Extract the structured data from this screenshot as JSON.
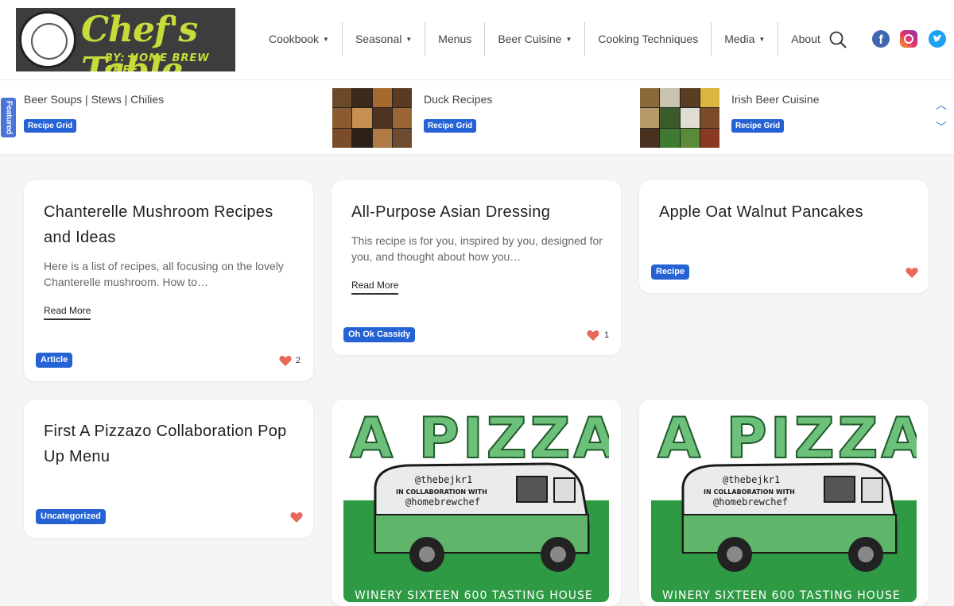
{
  "brand": {
    "title": "Chef's Table",
    "subtitle": "BY: HOME BREW CHEF"
  },
  "nav": {
    "items": [
      {
        "label": "Cookbook",
        "dropdown": true
      },
      {
        "label": "Seasonal",
        "dropdown": true
      },
      {
        "label": "Menus",
        "dropdown": false
      },
      {
        "label": "Beer Cuisine",
        "dropdown": true
      },
      {
        "label": "Cooking Techniques",
        "dropdown": false
      },
      {
        "label": "Media",
        "dropdown": true
      },
      {
        "label": "About",
        "dropdown": false
      }
    ],
    "caret": "▼"
  },
  "social": {
    "facebook": "f"
  },
  "featured": {
    "tab_label": "Featured",
    "items": [
      {
        "label": "Beer Soups | Stews | Chilies",
        "badge": "Recipe Grid"
      },
      {
        "label": "Duck Recipes",
        "badge": "Recipe Grid"
      },
      {
        "label": "Irish Beer Cuisine",
        "badge": "Recipe Grid"
      }
    ],
    "up_arrow": "︿",
    "down_arrow": "﹀"
  },
  "cards": [
    {
      "title": "Chanterelle Mushroom Recipes and Ideas",
      "excerpt": "Here is a list of recipes, all focusing on the lovely Chanterelle mushroom.   How to…",
      "read_more": "Read More",
      "badge": "Article",
      "likes": "2"
    },
    {
      "title": "All-Purpose Asian Dressing",
      "excerpt": "This recipe is for you, inspired by you, designed for you, and thought about how you…",
      "read_more": "Read More",
      "badge": "Oh Ok Cassidy",
      "likes": "1"
    },
    {
      "title": "Apple Oat Walnut Pancakes",
      "badge": "Recipe"
    },
    {
      "title": "First A Pizzazo Collaboration Pop Up Menu",
      "badge": "Uncategorized"
    }
  ],
  "poster": {
    "headline": "A PIZZAZO",
    "line1": "@thebejkr1",
    "line2": "IN COLLABORATION WITH",
    "line3": "@homebrewchef",
    "footer": "WINERY SIXTEEN 600 TASTING HOUSE"
  },
  "colors": {
    "accent": "#2563d5",
    "heart": "#e8685a",
    "logo_green": "#c7dc3b",
    "poster_green": "#2e9a44"
  }
}
